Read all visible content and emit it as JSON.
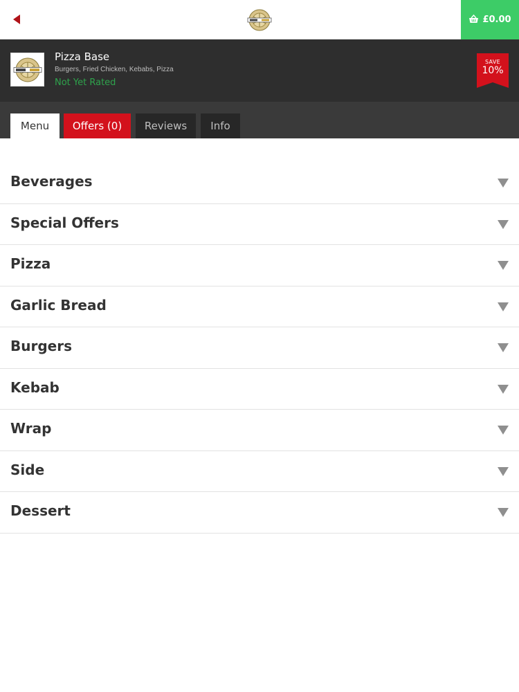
{
  "topbar": {
    "back_icon": "back-arrow-icon",
    "logo_icon": "pizza-base-logo",
    "basket": {
      "icon": "basket-icon",
      "amount": "£0.00"
    }
  },
  "restaurant": {
    "name": "Pizza Base",
    "cuisine": "Burgers, Fried Chicken, Kebabs, Pizza",
    "rating": "Not Yet Rated",
    "save_badge": {
      "label": "SAVE",
      "value": "10%"
    }
  },
  "tabs": [
    {
      "label": "Menu",
      "active": true
    },
    {
      "label": "Offers (0)"
    },
    {
      "label": "Reviews"
    },
    {
      "label": "Info"
    }
  ],
  "categories": [
    {
      "name": "Beverages"
    },
    {
      "name": "Special Offers"
    },
    {
      "name": "Pizza"
    },
    {
      "name": "Garlic Bread"
    },
    {
      "name": "Burgers"
    },
    {
      "name": "Kebab"
    },
    {
      "name": "Wrap"
    },
    {
      "name": "Side"
    },
    {
      "name": "Dessert"
    }
  ],
  "colors": {
    "accent_red": "#d3111c",
    "basket_green": "#3dcc67",
    "rating_green": "#2ea34c",
    "header_dark": "#2e2e2e"
  }
}
